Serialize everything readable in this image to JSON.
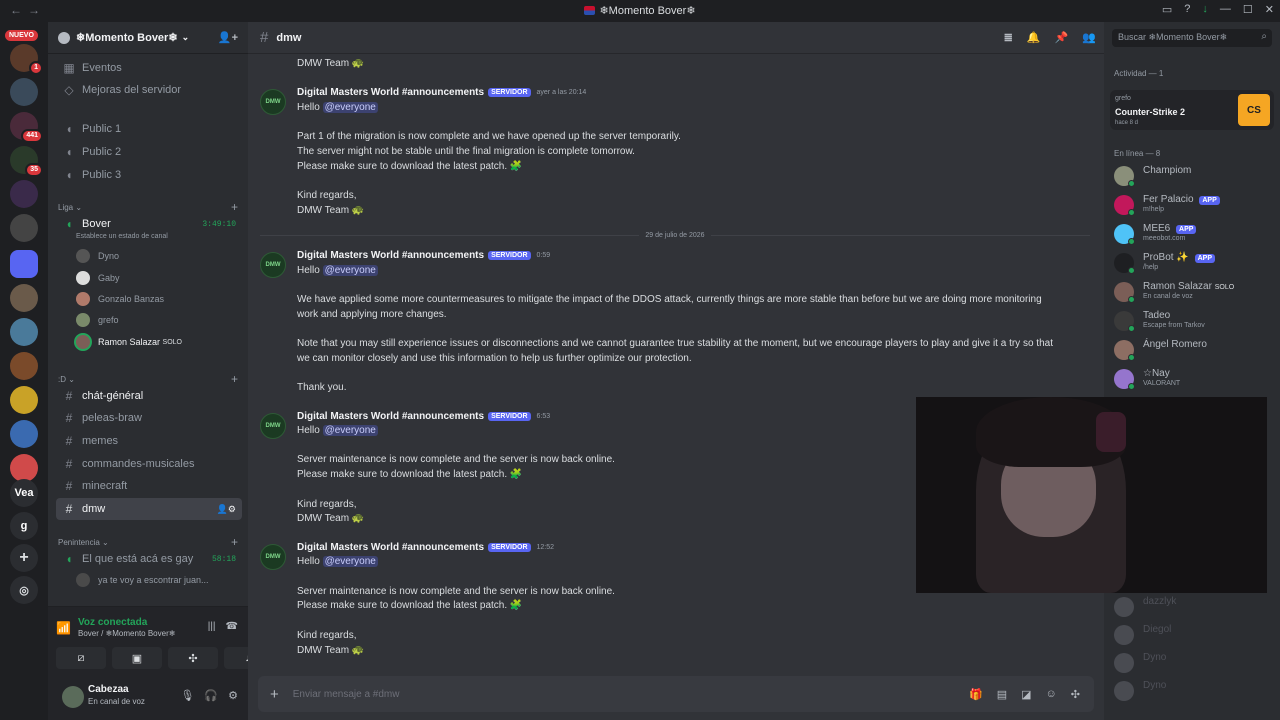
{
  "titlebar": {
    "title": "❄Momento Bover❄"
  },
  "guilds": {
    "nuevo": "NUEVO",
    "badges": [
      "1",
      "441",
      "35"
    ],
    "vea": "Vea",
    "g": "g"
  },
  "server": {
    "name": "❄Momento Bover❄"
  },
  "channels_top": [
    {
      "label": "Eventos"
    },
    {
      "label": "Mejoras del servidor"
    }
  ],
  "voice_public": [
    {
      "label": "Public 1"
    },
    {
      "label": "Public 2"
    },
    {
      "label": "Public 3"
    }
  ],
  "cat_liga": "Liga",
  "liga": {
    "label": "Bover",
    "timer": "3:49:10",
    "status": "Establece un estado de canal"
  },
  "liga_users": [
    {
      "name": "Dyno"
    },
    {
      "name": "Gaby"
    },
    {
      "name": "Gonzalo Banzas"
    },
    {
      "name": "grefo"
    },
    {
      "name": "Ramon Salazar",
      "tag": "SOLO"
    }
  ],
  "cat_d": ":D",
  "text_channels": [
    {
      "label": "chát-général"
    },
    {
      "label": "peleas-braw"
    },
    {
      "label": "memes"
    },
    {
      "label": "commandes-musicales"
    },
    {
      "label": "minecraft"
    },
    {
      "label": "dmw"
    }
  ],
  "cat_penitencia": "Penintencia",
  "penitencia": {
    "label": "El que está acá es gay",
    "timer": "58:18",
    "status": "ya te voy a escontrar juan..."
  },
  "voice_panel": {
    "title": "Voz conectada",
    "sub": "Bover / ❄Momento Bover❄"
  },
  "user": {
    "name": "Cabezaa",
    "status": "En canal de voz"
  },
  "channel": {
    "name": "dmw"
  },
  "messages": {
    "signoff_top": "DMW Team 🐢",
    "author": "Digital Masters World #announcements",
    "server_tag": "SERVIDOR",
    "m1": {
      "time": "ayer a las 20:14",
      "hello": "Hello",
      "mention": "@everyone",
      "l1": "Part 1 of the migration is now complete and we have opened up the server temporarily.",
      "l2": "The server might not be stable until the final migration is complete tomorrow.",
      "l3": "Please make sure to download the latest patch. 🧩",
      "kr": "Kind regards,",
      "sign": "DMW Team 🐢"
    },
    "date_divider": "29 de julio de 2026",
    "m2": {
      "time": "0:59",
      "hello": "Hello",
      "mention": "@everyone",
      "p1a": "We have applied some more countermeasures to mitigate the impact of the DDOS attack, currently things are more stable than before but we are doing more monitoring",
      "p1b": "work and applying more changes.",
      "p2a": "Note that you may still experience issues or disconnections and we cannot guarantee true stability at the moment, but we encourage players to play and give it a try so that",
      "p2b": "we can monitor closely and use this information to help us further optimize our protection.",
      "ty": "Thank you."
    },
    "m3": {
      "time": "6:53",
      "hello": "Hello",
      "mention": "@everyone",
      "l1": "Server maintenance is now complete and the server is now back online.",
      "l2": "Please make sure to download the latest patch. 🧩",
      "kr": "Kind regards,",
      "sign": "DMW Team 🐢"
    },
    "m4": {
      "time": "12:52",
      "hello": "Hello",
      "mention": "@everyone",
      "l1": "Server maintenance is now complete and the server is now back online.",
      "l2": "Please make sure to download the latest patch. 🧩",
      "kr": "Kind regards,",
      "sign": "DMW Team 🐢"
    }
  },
  "composer": {
    "placeholder": "Enviar mensaje a #dmw"
  },
  "search": {
    "placeholder": "Buscar ❄Momento Bover❄"
  },
  "activity": {
    "header": "Actividad — 1",
    "user": "grefo",
    "game": "Counter-Strike 2",
    "time": "hace 8 d"
  },
  "online_header": "En línea — 8",
  "members": [
    {
      "name": "Champiom",
      "status": "",
      "color": "#8a8f7a"
    },
    {
      "name": "Fer Palacio",
      "tag": "APP",
      "status": "m!help",
      "color": "#c2185b"
    },
    {
      "name": "MEE6",
      "tag": "APP",
      "status": "meeobot.com",
      "color": "#4fc3f7"
    },
    {
      "name": "ProBot ✨",
      "tag": "APP",
      "status": "/help",
      "color": "#1e1f22"
    },
    {
      "name": "Ramon Salazar",
      "tag2": "SOLO",
      "status": "En canal de voz",
      "color": "#7b5e57"
    },
    {
      "name": "Tadeo",
      "status": "Escape from Tarkov",
      "color": "#3a3a3a"
    },
    {
      "name": "Ángel Romero",
      "status": "",
      "color": "#8d6e63"
    },
    {
      "name": "☆Nay",
      "status": "VALORANT",
      "color": "#9575cd"
    }
  ],
  "members_offline": [
    {
      "name": "dazzlyk"
    },
    {
      "name": "Diegol"
    },
    {
      "name": "Dyno"
    },
    {
      "name": "Dyno"
    }
  ]
}
